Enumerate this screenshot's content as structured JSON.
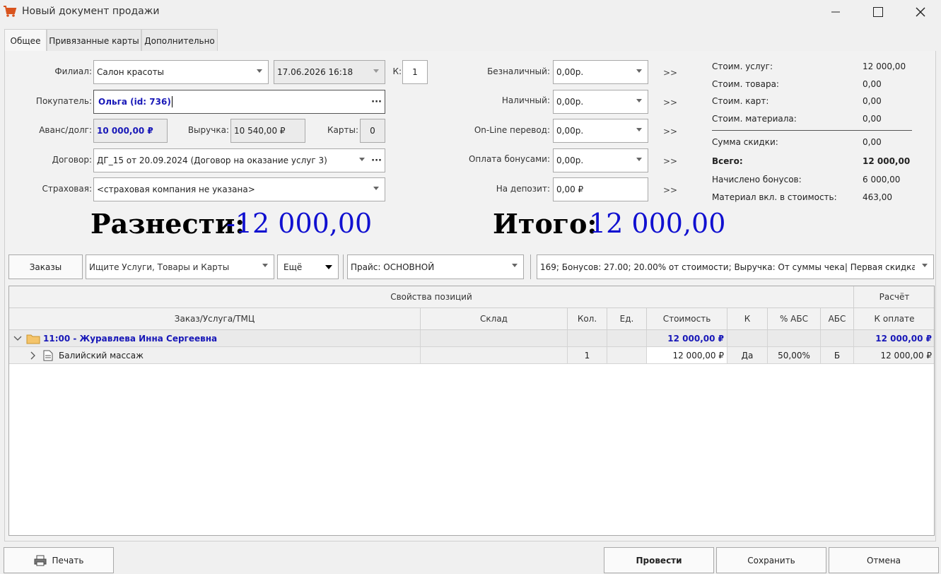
{
  "window": {
    "title": "Новый документ продажи",
    "icon": "shopping-cart-icon"
  },
  "tabs": [
    {
      "label": "Общее",
      "active": true
    },
    {
      "label": "Привязанные карты",
      "active": false
    },
    {
      "label": "Дополнительно",
      "active": false
    }
  ],
  "form": {
    "branch_label": "Филиал:",
    "branch_value": "Салон красоты",
    "datetime_value": "17.06.2026 16:18",
    "k_label": "К:",
    "k_value": "1",
    "buyer_label": "Покупатель:",
    "buyer_value": "Ольга  (id: 736)",
    "advance_label": "Аванс/долг:",
    "advance_value": "10 000,00 ₽",
    "revenue_label": "Выручка:",
    "revenue_value": "10 540,00 ₽",
    "cards_label": "Карты:",
    "cards_value": "0",
    "contract_label": "Договор:",
    "contract_value": "ДГ_15 от 20.09.2024 (Договор на оказание услуг 3)",
    "insurer_label": "Страховая:",
    "insurer_value": "<страховая компания не указана>"
  },
  "payments": [
    {
      "label": "Безналичный:",
      "value": "0,00р.",
      "arrow": ">>",
      "dropdown": true
    },
    {
      "label": "Наличный:",
      "value": "0,00р.",
      "arrow": ">>",
      "dropdown": true
    },
    {
      "label": "On-Line перевод:",
      "value": "0,00р.",
      "arrow": ">>",
      "dropdown": true
    },
    {
      "label": "Оплата бонусами:",
      "value": "0,00р.",
      "arrow": ">>",
      "dropdown": true
    },
    {
      "label": "На депозит:",
      "value": "0,00 ₽",
      "arrow": ">>",
      "dropdown": false
    }
  ],
  "summary": {
    "services_label": "Стоим. услуг:",
    "services_value": "12 000,00",
    "goods_label": "Стоим. товара:",
    "goods_value": "0,00",
    "cards_label": "Стоим. карт:",
    "cards_value": "0,00",
    "material_label": "Стоим. материала:",
    "material_value": "0,00",
    "discount_label": "Сумма скидки:",
    "discount_value": "0,00",
    "total_label": "Всего:",
    "total_value": "12 000,00",
    "bonus_label": "Начислено бонусов:",
    "bonus_value": "6 000,00",
    "matincl_label": "Материал вкл. в стоимость:",
    "matincl_value": "463,00"
  },
  "totals": {
    "distribute_label": "Разнести:",
    "distribute_value": "-12 000,00",
    "itogo_label": "Итого:",
    "itogo_value": "12 000,00"
  },
  "toolbar": {
    "orders_label": "Заказы",
    "search_placeholder": "Ищите Услуги, Товары и Карты",
    "more_label": "Ещё",
    "price_label": "Прайс: ОСНОВНОЙ",
    "promo_label": "169; Бонусов: 27.00; 20.00% от стоимости; Выручка: От суммы чека| Первая скидка, дале"
  },
  "grid": {
    "group_header_left": "Свойства позиций",
    "group_header_right": "Расчёт",
    "columns": [
      "Заказ/Услуга/ТМЦ",
      "Склад",
      "Кол.",
      "Ед.",
      "Стоимость",
      "К",
      "% АБС",
      "АБС",
      "К оплате"
    ],
    "group_row": {
      "title": "11:00 - Журавлева Инна Сергеевна",
      "cost": "12 000,00 ₽",
      "to_pay": "12 000,00 ₽"
    },
    "rows": [
      {
        "name": "Балийский массаж",
        "warehouse": "",
        "qty": "1",
        "unit": "",
        "cost": "12 000,00 ₽",
        "k": "Да",
        "abs_pct": "50,00%",
        "abs": "Б",
        "to_pay": "12 000,00 ₽"
      }
    ]
  },
  "footer": {
    "print_label": "Печать",
    "post_label": "Провести",
    "save_label": "Сохранить",
    "cancel_label": "Отмена"
  },
  "colors": {
    "accent_blue": "#1010d0",
    "cart_icon": "#d9541e"
  }
}
